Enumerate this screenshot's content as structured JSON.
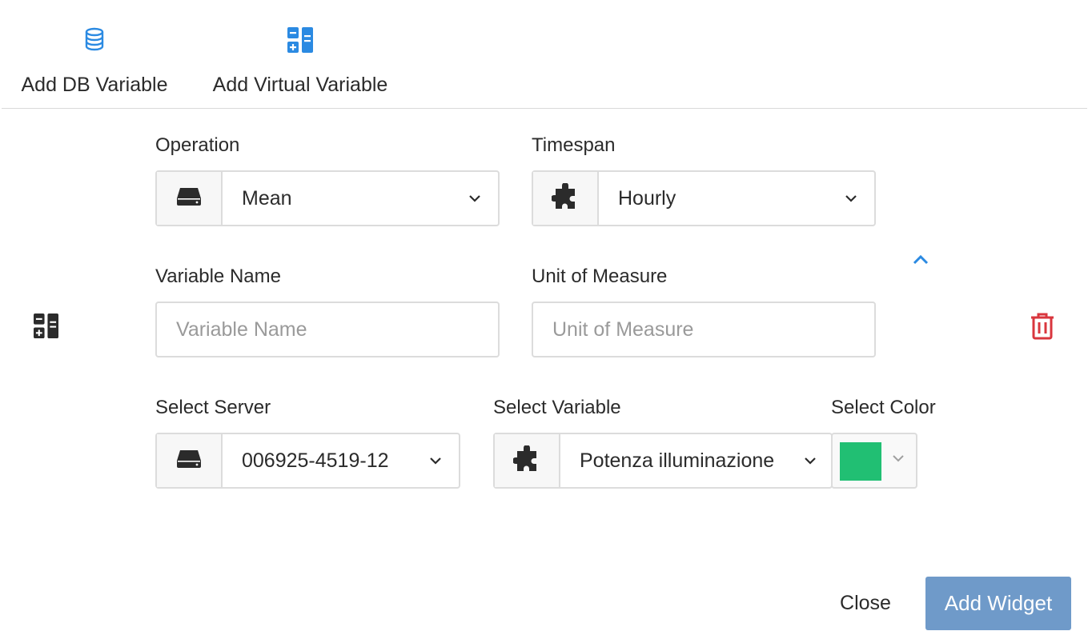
{
  "toolbar": {
    "add_db_variable": "Add DB Variable",
    "add_virtual_variable": "Add Virtual Variable"
  },
  "form": {
    "operation": {
      "label": "Operation",
      "value": "Mean",
      "icon": "server-icon"
    },
    "timespan": {
      "label": "Timespan",
      "value": "Hourly",
      "icon": "puzzle-icon"
    },
    "variable_name": {
      "label": "Variable Name",
      "placeholder": "Variable Name",
      "value": ""
    },
    "unit_of_measure": {
      "label": "Unit of Measure",
      "placeholder": "Unit of Measure",
      "value": ""
    },
    "server": {
      "label": "Select Server",
      "value": "006925-4519-12",
      "icon": "server-icon"
    },
    "variable": {
      "label": "Select Variable",
      "value": "Potenza illuminazione",
      "icon": "puzzle-icon"
    },
    "color": {
      "label": "Select Color",
      "value": "#21bf73"
    }
  },
  "footer": {
    "close_label": "Close",
    "add_widget_label": "Add Widget"
  },
  "colors": {
    "accent_blue": "#2b8ae2",
    "danger_red": "#d9363e",
    "primary_button": "#6f9ac9"
  }
}
